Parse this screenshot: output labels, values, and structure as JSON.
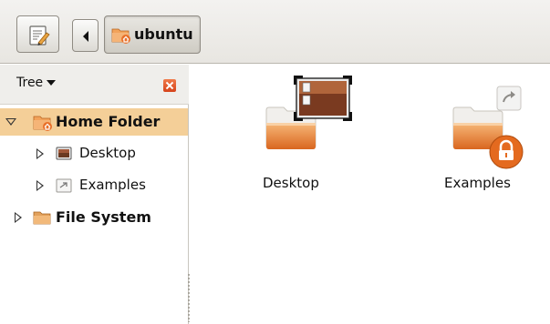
{
  "toolbar": {
    "edit_icon": "text-editor-icon",
    "back_icon": "arrow-left-icon",
    "breadcrumb": {
      "label": "ubuntu",
      "icon": "home-folder-icon"
    }
  },
  "sidebar": {
    "view_selector": "Tree",
    "close_icon": "close-icon",
    "tree": [
      {
        "label": "Home Folder",
        "level": 0,
        "expanded": true,
        "selected": true,
        "icon": "home-folder-icon"
      },
      {
        "label": "Desktop",
        "level": 1,
        "expanded": false,
        "selected": false,
        "icon": "desktop-icon"
      },
      {
        "label": "Examples",
        "level": 1,
        "expanded": false,
        "selected": false,
        "icon": "symlink-icon"
      },
      {
        "label": "File System",
        "level": 0,
        "expanded": false,
        "selected": false,
        "icon": "folder-icon"
      }
    ]
  },
  "main": {
    "items": [
      {
        "label": "Desktop",
        "icon": "folder-icon",
        "emblem": "desktop-emblem"
      },
      {
        "label": "Examples",
        "icon": "folder-icon",
        "emblem": "lock-emblem"
      }
    ]
  },
  "colors": {
    "selection": "#f4cf98",
    "folder_orange": "#e8702a",
    "toolbar_bg": "#e8e6e1"
  }
}
